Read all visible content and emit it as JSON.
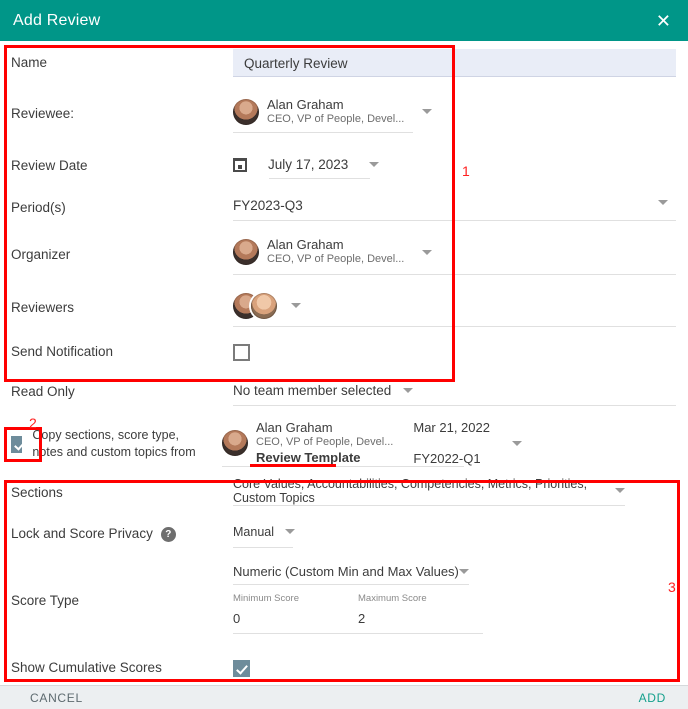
{
  "header": {
    "title": "Add Review",
    "close_label": "✕"
  },
  "form": {
    "name": {
      "label": "Name",
      "value": "Quarterly Review",
      "placeholder": "Name"
    },
    "reviewee": {
      "label": "Reviewee:",
      "person_name": "Alan Graham",
      "person_role": "CEO, VP of People, Devel..."
    },
    "review_date": {
      "label": "Review Date",
      "value": "July 17, 2023"
    },
    "periods": {
      "label": "Period(s)",
      "value": "FY2023-Q3"
    },
    "organizer": {
      "label": "Organizer",
      "person_name": "Alan Graham",
      "person_role": "CEO, VP of People, Devel..."
    },
    "reviewers": {
      "label": "Reviewers"
    },
    "send_notification": {
      "label": "Send Notification",
      "checked": false
    },
    "read_only": {
      "label": "Read Only",
      "value": "No team member selected"
    },
    "copy_from": {
      "label": "Copy sections, score type, notes and custom topics from",
      "checked": true,
      "person_name": "Alan Graham",
      "person_role": "CEO, VP of People, Devel...",
      "template_name": "Review Template",
      "date": "Mar 21, 2022",
      "period": "FY2022-Q1"
    },
    "sections": {
      "label": "Sections",
      "value": "Core Values, Accountabilities, Competencies, Metrics, Priorities, Custom Topics"
    },
    "lock_privacy": {
      "label": "Lock and Score Privacy",
      "help": "?",
      "value": "Manual"
    },
    "score_type": {
      "label": "Score Type",
      "value": "Numeric (Custom Min and Max Values)",
      "min_label": "Minimum Score",
      "min_value": "0",
      "max_label": "Maximum Score",
      "max_value": "2"
    },
    "show_cumulative": {
      "label": "Show Cumulative Scores",
      "checked": true
    }
  },
  "footer": {
    "cancel_label": "CANCEL",
    "add_label": "ADD"
  },
  "annotations": {
    "one": "1",
    "two": "2",
    "three": "3"
  },
  "colors": {
    "header_bg": "#009688",
    "accent": "#14a08c",
    "annotation": "#ff0000",
    "checkbox_checked": "#6e8c9b",
    "name_field_bg": "#e9edf7"
  }
}
